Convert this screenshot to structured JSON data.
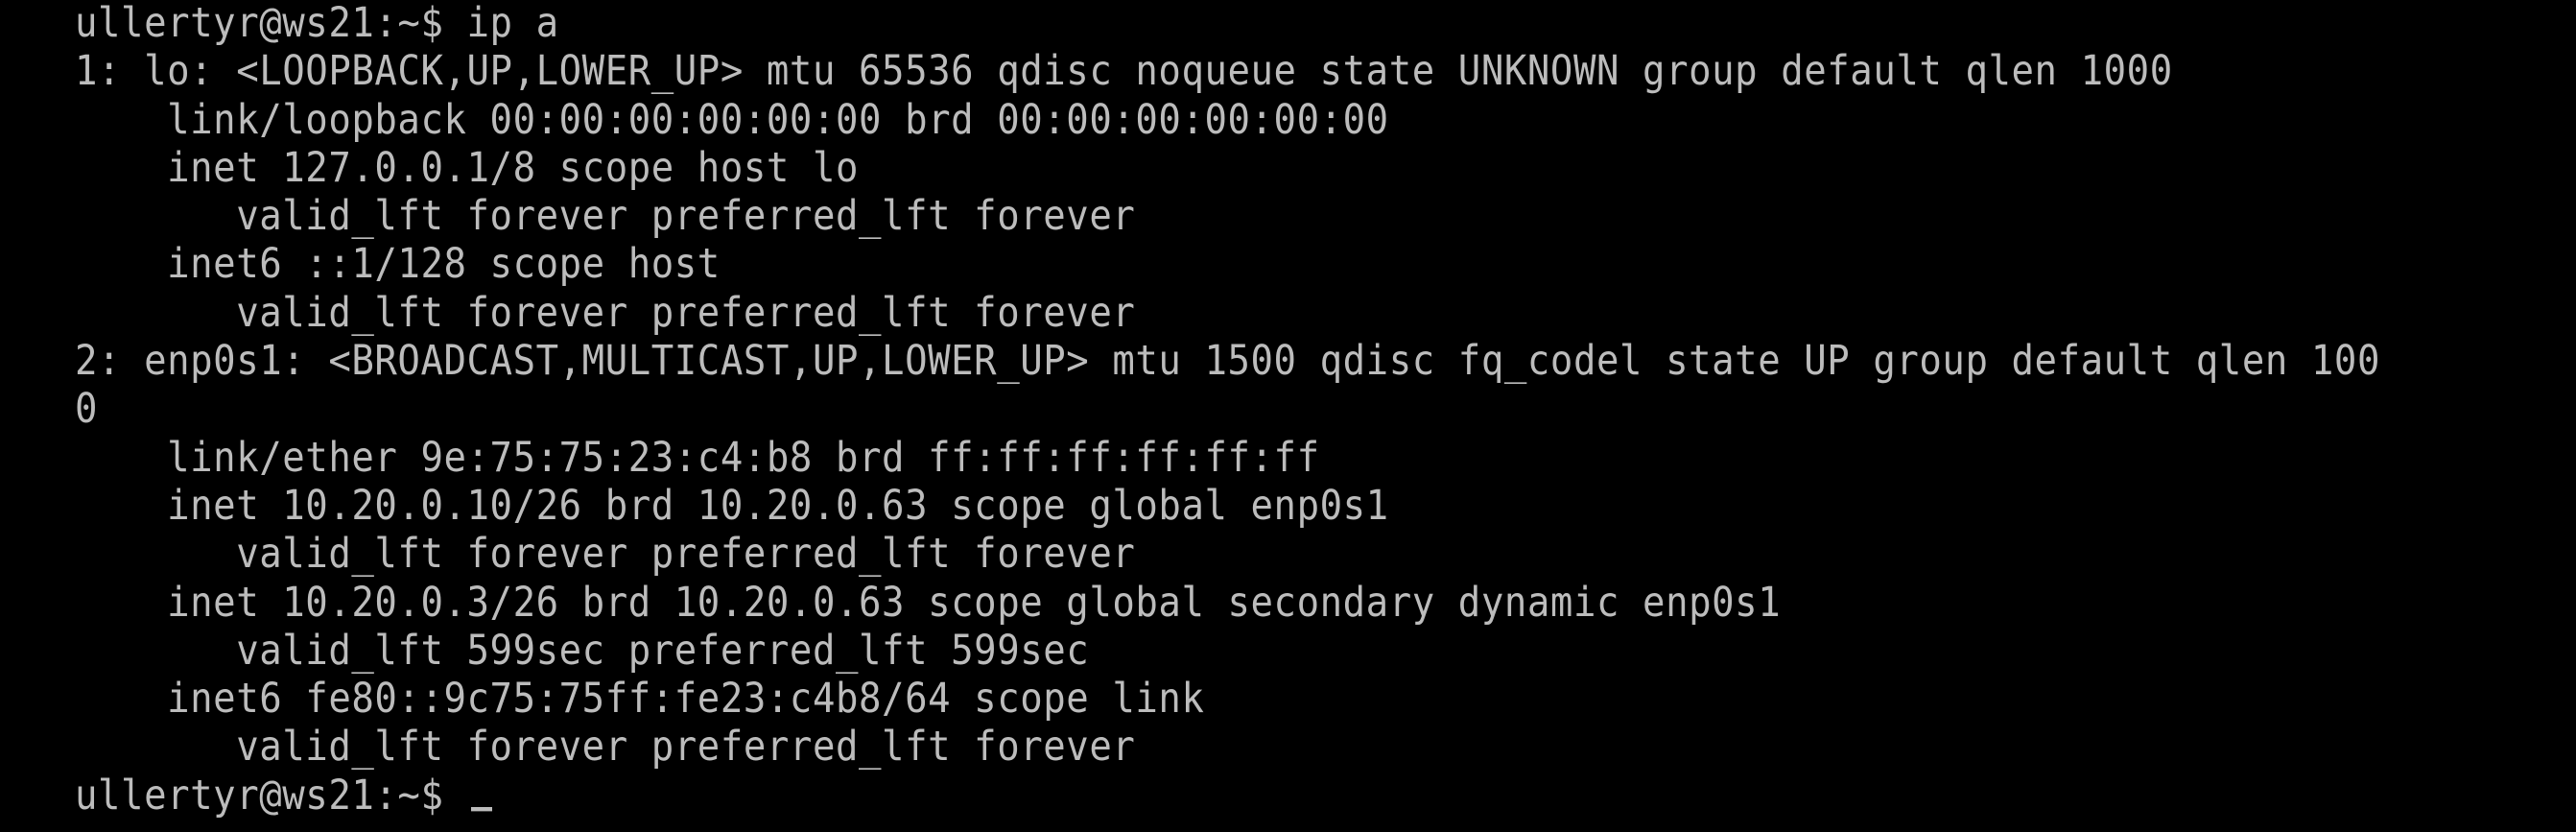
{
  "terminal": {
    "lines": [
      "ullertyr@ws21:~$ ip a",
      "1: lo: <LOOPBACK,UP,LOWER_UP> mtu 65536 qdisc noqueue state UNKNOWN group default qlen 1000",
      "    link/loopback 00:00:00:00:00:00 brd 00:00:00:00:00:00",
      "    inet 127.0.0.1/8 scope host lo",
      "       valid_lft forever preferred_lft forever",
      "    inet6 ::1/128 scope host",
      "       valid_lft forever preferred_lft forever",
      "2: enp0s1: <BROADCAST,MULTICAST,UP,LOWER_UP> mtu 1500 qdisc fq_codel state UP group default qlen 100",
      "0",
      "    link/ether 9e:75:75:23:c4:b8 brd ff:ff:ff:ff:ff:ff",
      "    inet 10.20.0.10/26 brd 10.20.0.63 scope global enp0s1",
      "       valid_lft forever preferred_lft forever",
      "    inet 10.20.0.3/26 brd 10.20.0.63 scope global secondary dynamic enp0s1",
      "       valid_lft 599sec preferred_lft 599sec",
      "    inet6 fe80::9c75:75ff:fe23:c4b8/64 scope link",
      "       valid_lft forever preferred_lft forever"
    ],
    "prompt": "ullertyr@ws21:~$ ",
    "colors": {
      "background": "#000000",
      "text": "#bcbcbc"
    }
  }
}
